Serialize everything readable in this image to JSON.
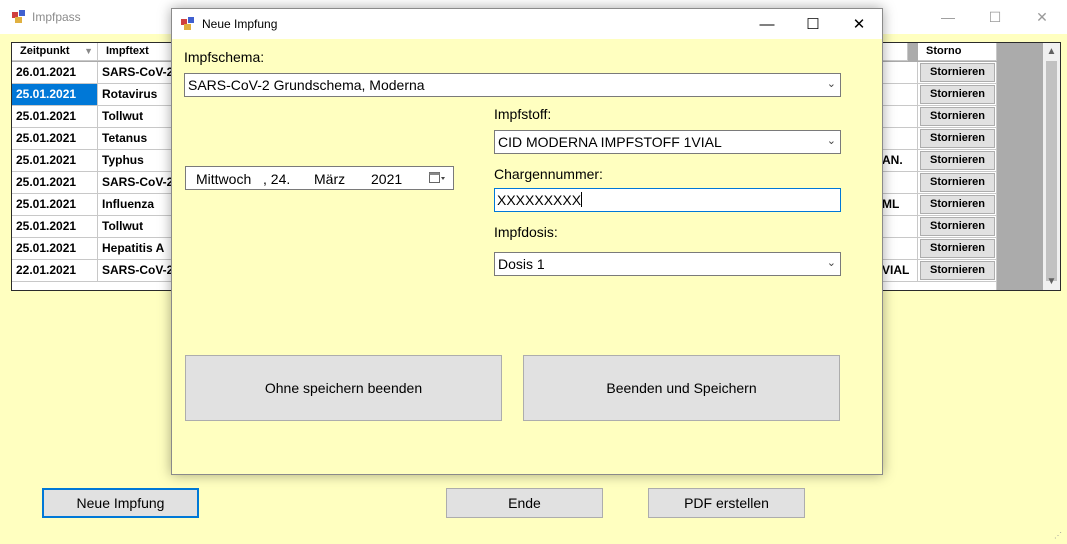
{
  "parent": {
    "title": "Impfpass",
    "columns": {
      "zeitpunkt": "Zeitpunkt",
      "impftext": "Impftext",
      "storno": "Storno"
    },
    "rows": [
      {
        "date": "26.01.2021",
        "text": "SARS-CoV-2",
        "right": "",
        "storno": "Stornieren"
      },
      {
        "date": "25.01.2021",
        "text": "Rotavirus",
        "right": "",
        "storno": "Stornieren"
      },
      {
        "date": "25.01.2021",
        "text": "Tollwut",
        "right": "",
        "storno": "Stornieren"
      },
      {
        "date": "25.01.2021",
        "text": "Tetanus",
        "right": "",
        "storno": "Stornieren"
      },
      {
        "date": "25.01.2021",
        "text": "Typhus",
        "right": "AN.",
        "storno": "Stornieren"
      },
      {
        "date": "25.01.2021",
        "text": "SARS-CoV-2",
        "right": "",
        "storno": "Stornieren"
      },
      {
        "date": "25.01.2021",
        "text": "Influenza",
        "right": "ML",
        "storno": "Stornieren"
      },
      {
        "date": "25.01.2021",
        "text": "Tollwut",
        "right": "",
        "storno": "Stornieren"
      },
      {
        "date": "25.01.2021",
        "text": "Hepatitis A",
        "right": "",
        "storno": "Stornieren"
      },
      {
        "date": "22.01.2021",
        "text": "SARS-CoV-2",
        "right": "VIAL",
        "storno": "Stornieren"
      }
    ],
    "buttons": {
      "neue": "Neue Impfung",
      "ende": "Ende",
      "pdf": "PDF erstellen"
    }
  },
  "dialog": {
    "title": "Neue Impfung",
    "impfschema_label": "Impfschema:",
    "impfschema_value": "SARS-CoV-2 Grundschema, Moderna",
    "impfstoff_label": "Impfstoff:",
    "impfstoff_value": "CID MODERNA IMPFSTOFF 1VIAL",
    "charge_label": "Chargennummer:",
    "charge_value": "XXXXXXXXX",
    "dosis_label": "Impfdosis:",
    "dosis_value": "Dosis 1",
    "date": {
      "weekday": "Mittwoch",
      "day": ", 24.",
      "month": "März",
      "year": "2021"
    },
    "btn_cancel": "Ohne speichern beenden",
    "btn_save": "Beenden und  Speichern"
  },
  "icons": {
    "app": "app-icon",
    "calendar": "calendar-icon",
    "chevron": "chevron-down-icon"
  }
}
